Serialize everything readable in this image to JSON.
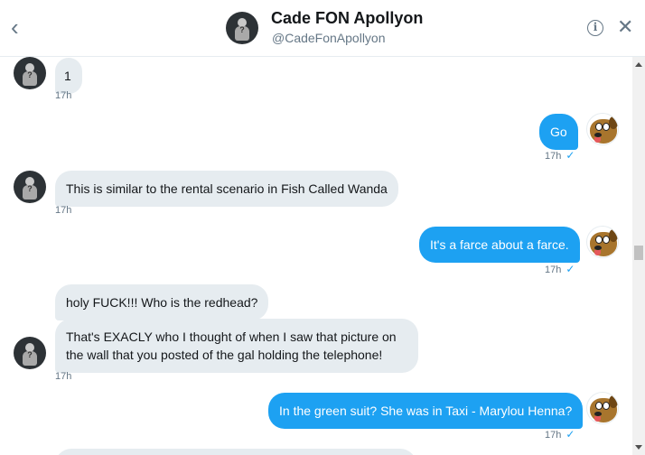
{
  "header": {
    "back_icon": "chevron-left-icon",
    "name": "Cade FON Apollyon",
    "handle": "@CadeFonApollyon",
    "info_icon": "info-icon",
    "close_icon": "close-icon"
  },
  "messages": [
    {
      "side": "in",
      "text": "1",
      "time": "17h"
    },
    {
      "side": "out",
      "text": "Go",
      "time": "17h"
    },
    {
      "side": "in",
      "text": "This is similar to the rental scenario in Fish Called Wanda",
      "time": "17h"
    },
    {
      "side": "out",
      "text": "It's a farce about a farce.",
      "time": "17h"
    },
    {
      "side": "in",
      "text": "holy FUCK!!! Who is the redhead?",
      "time": ""
    },
    {
      "side": "in",
      "text": "That's EXACLY who I thought of when I saw that picture on the wall that you posted of the gal holding the telephone!",
      "time": "17h"
    },
    {
      "side": "out",
      "text": "In the green suit? She was in Taxi - Marylou Henna?",
      "time": "17h"
    }
  ],
  "colors": {
    "outgoing_bubble": "#1da1f2",
    "incoming_bubble": "#e6ecf0",
    "check": "#1da1f2"
  }
}
